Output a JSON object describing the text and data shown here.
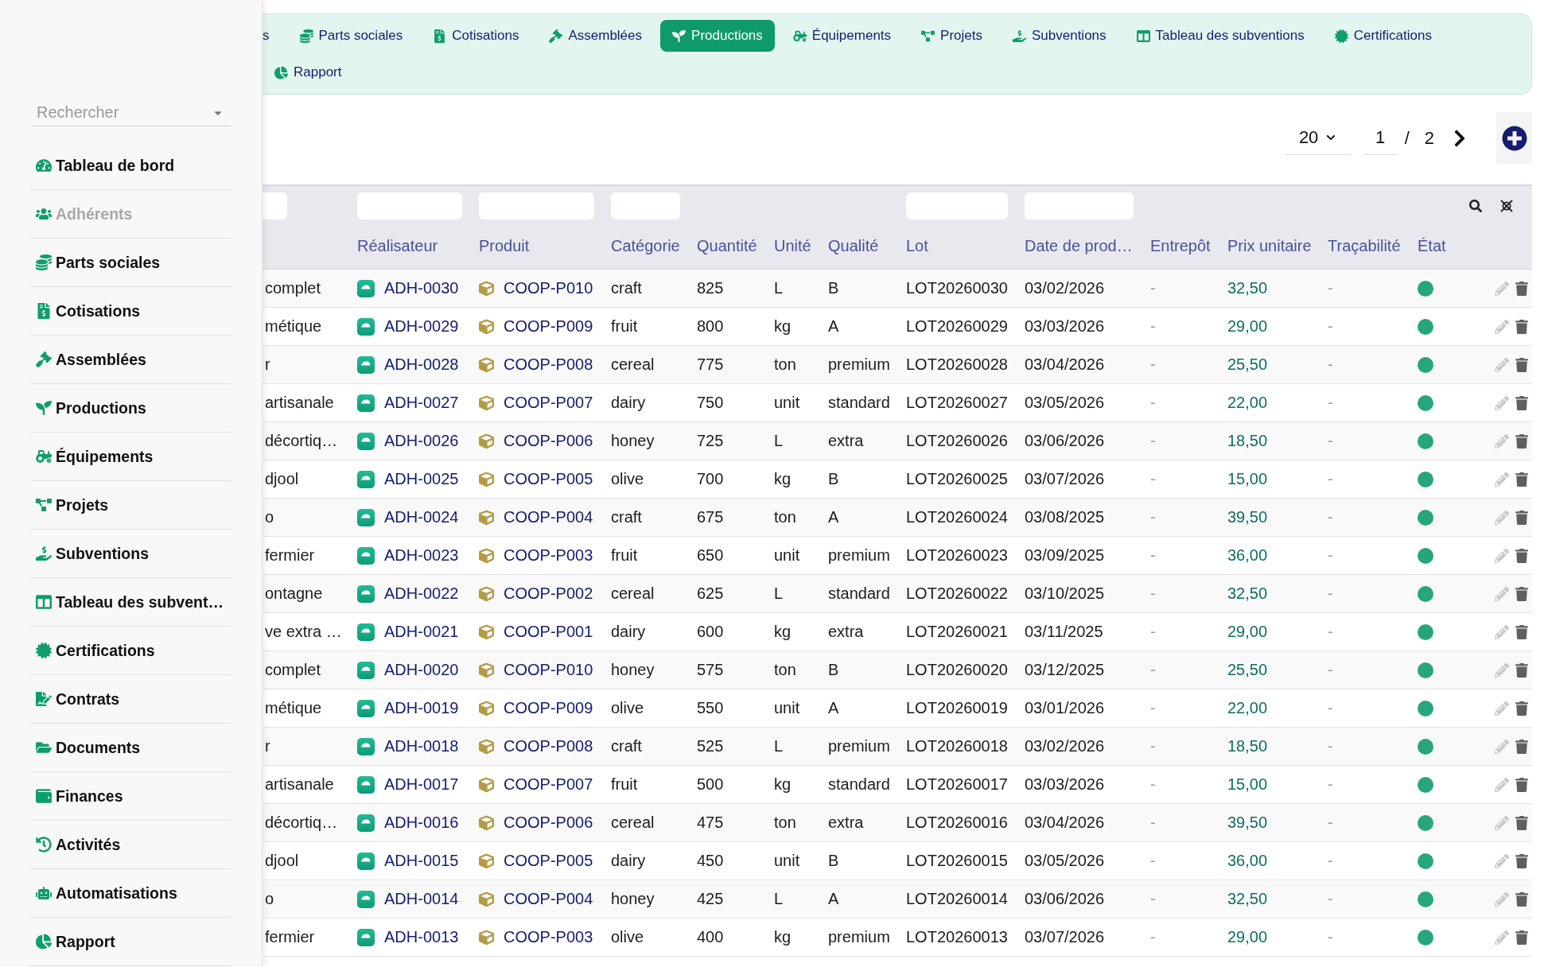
{
  "sidebar": {
    "search": {
      "placeholder": "Rechercher"
    },
    "items": [
      {
        "label": "Tableau de bord",
        "disabled": false
      },
      {
        "label": "Adhérents",
        "disabled": true
      },
      {
        "label": "Parts sociales",
        "disabled": false
      },
      {
        "label": "Cotisations",
        "disabled": false
      },
      {
        "label": "Assemblées",
        "disabled": false
      },
      {
        "label": "Productions",
        "disabled": false
      },
      {
        "label": "Équipements",
        "disabled": false
      },
      {
        "label": "Projets",
        "disabled": false
      },
      {
        "label": "Subventions",
        "disabled": false
      },
      {
        "label": "Tableau des subvent…",
        "disabled": false
      },
      {
        "label": "Certifications",
        "disabled": false
      },
      {
        "label": "Contrats",
        "disabled": false
      },
      {
        "label": "Documents",
        "disabled": false
      },
      {
        "label": "Finances",
        "disabled": false
      },
      {
        "label": "Activités",
        "disabled": false
      },
      {
        "label": "Automatisations",
        "disabled": false
      },
      {
        "label": "Rapport",
        "disabled": false
      }
    ]
  },
  "nav": {
    "tabs": [
      {
        "label": "s",
        "selected": false
      },
      {
        "label": "Parts sociales",
        "selected": false
      },
      {
        "label": "Cotisations",
        "selected": false
      },
      {
        "label": "Assemblées",
        "selected": false
      },
      {
        "label": "Productions",
        "selected": true
      },
      {
        "label": "Équipements",
        "selected": false
      },
      {
        "label": "Projets",
        "selected": false
      },
      {
        "label": "Subventions",
        "selected": false
      },
      {
        "label": "Tableau des subventions",
        "selected": false
      },
      {
        "label": "Certifications",
        "selected": false
      },
      {
        "label": "Rapport",
        "selected": false
      }
    ]
  },
  "pagination": {
    "page_size": "20",
    "page": "1",
    "separator": "/",
    "total_pages": "2"
  },
  "table": {
    "columns": [
      {
        "filter": true
      },
      {
        "label": "Réalisateur",
        "filter": true
      },
      {
        "label": "Produit",
        "filter": true
      },
      {
        "label": "Catégorie",
        "filter": true
      },
      {
        "label": "Quantité",
        "filter": false
      },
      {
        "label": "Unité",
        "filter": false
      },
      {
        "label": "Qualité",
        "filter": false
      },
      {
        "label": "Lot",
        "filter": true
      },
      {
        "label": "Date de prod…",
        "filter": true
      },
      {
        "label": "Entrepôt",
        "filter": false
      },
      {
        "label": "Prix unitaire",
        "filter": false
      },
      {
        "label": "Traçabilité",
        "filter": false
      },
      {
        "label": "État",
        "filter": false
      }
    ],
    "rows": [
      {
        "cells": [
          "complet",
          "ADH-0030",
          "COOP-P010",
          "craft",
          "825",
          "L",
          "B",
          "LOT20260030",
          "03/02/2026",
          "-",
          "32,50",
          "-"
        ],
        "color": "#26a67a"
      },
      {
        "cells": [
          "métique",
          "ADH-0029",
          "COOP-P009",
          "fruit",
          "800",
          "kg",
          "A",
          "LOT20260029",
          "03/03/2026",
          "-",
          "29,00",
          "-"
        ],
        "color": "#26a67a"
      },
      {
        "cells": [
          "r",
          "ADH-0028",
          "COOP-P008",
          "cereal",
          "775",
          "ton",
          "premium",
          "LOT20260028",
          "03/04/2026",
          "-",
          "25,50",
          "-"
        ],
        "color": "#26a67a"
      },
      {
        "cells": [
          "artisanale",
          "ADH-0027",
          "COOP-P007",
          "dairy",
          "750",
          "unit",
          "standard",
          "LOT20260027",
          "03/05/2026",
          "-",
          "22,00",
          "-"
        ],
        "color": "#26a67a"
      },
      {
        "cells": [
          "décortiq…",
          "ADH-0026",
          "COOP-P006",
          "honey",
          "725",
          "L",
          "extra",
          "LOT20260026",
          "03/06/2026",
          "-",
          "18,50",
          "-"
        ],
        "color": "#26a67a"
      },
      {
        "cells": [
          "djool",
          "ADH-0025",
          "COOP-P005",
          "olive",
          "700",
          "kg",
          "B",
          "LOT20260025",
          "03/07/2026",
          "-",
          "15,00",
          "-"
        ],
        "color": "#26a67a"
      },
      {
        "cells": [
          "o",
          "ADH-0024",
          "COOP-P004",
          "craft",
          "675",
          "ton",
          "A",
          "LOT20260024",
          "03/08/2025",
          "-",
          "39,50",
          "-"
        ],
        "color": "#26a67a"
      },
      {
        "cells": [
          "fermier",
          "ADH-0023",
          "COOP-P003",
          "fruit",
          "650",
          "unit",
          "premium",
          "LOT20260023",
          "03/09/2025",
          "-",
          "36,00",
          "-"
        ],
        "color": "#26a67a"
      },
      {
        "cells": [
          "ontagne",
          "ADH-0022",
          "COOP-P002",
          "cereal",
          "625",
          "L",
          "standard",
          "LOT20260022",
          "03/10/2025",
          "-",
          "32,50",
          "-"
        ],
        "color": "#26a67a"
      },
      {
        "cells": [
          "ve extra …",
          "ADH-0021",
          "COOP-P001",
          "dairy",
          "600",
          "kg",
          "extra",
          "LOT20260021",
          "03/11/2025",
          "-",
          "29,00",
          "-"
        ],
        "color": "#26a67a"
      },
      {
        "cells": [
          "complet",
          "ADH-0020",
          "COOP-P010",
          "honey",
          "575",
          "ton",
          "B",
          "LOT20260020",
          "03/12/2025",
          "-",
          "25,50",
          "-"
        ],
        "color": "#26a67a"
      },
      {
        "cells": [
          "métique",
          "ADH-0019",
          "COOP-P009",
          "olive",
          "550",
          "unit",
          "A",
          "LOT20260019",
          "03/01/2026",
          "-",
          "22,00",
          "-"
        ],
        "color": "#26a67a"
      },
      {
        "cells": [
          "r",
          "ADH-0018",
          "COOP-P008",
          "craft",
          "525",
          "L",
          "premium",
          "LOT20260018",
          "03/02/2026",
          "-",
          "18,50",
          "-"
        ],
        "color": "#26a67a"
      },
      {
        "cells": [
          "artisanale",
          "ADH-0017",
          "COOP-P007",
          "fruit",
          "500",
          "kg",
          "standard",
          "LOT20260017",
          "03/03/2026",
          "-",
          "15,00",
          "-"
        ],
        "color": "#26a67a"
      },
      {
        "cells": [
          "décortiq…",
          "ADH-0016",
          "COOP-P006",
          "cereal",
          "475",
          "ton",
          "extra",
          "LOT20260016",
          "03/04/2026",
          "-",
          "39,50",
          "-"
        ],
        "color": "#26a67a"
      },
      {
        "cells": [
          "djool",
          "ADH-0015",
          "COOP-P005",
          "dairy",
          "450",
          "unit",
          "B",
          "LOT20260015",
          "03/05/2026",
          "-",
          "36,00",
          "-"
        ],
        "color": "#26a67a"
      },
      {
        "cells": [
          "o",
          "ADH-0014",
          "COOP-P004",
          "honey",
          "425",
          "L",
          "A",
          "LOT20260014",
          "03/06/2026",
          "-",
          "32,50",
          "-"
        ],
        "color": "#26a67a"
      },
      {
        "cells": [
          "fermier",
          "ADH-0013",
          "COOP-P003",
          "olive",
          "400",
          "kg",
          "premium",
          "LOT20260013",
          "03/07/2026",
          "-",
          "29,00",
          "-"
        ],
        "color": "#26a67a"
      }
    ]
  }
}
